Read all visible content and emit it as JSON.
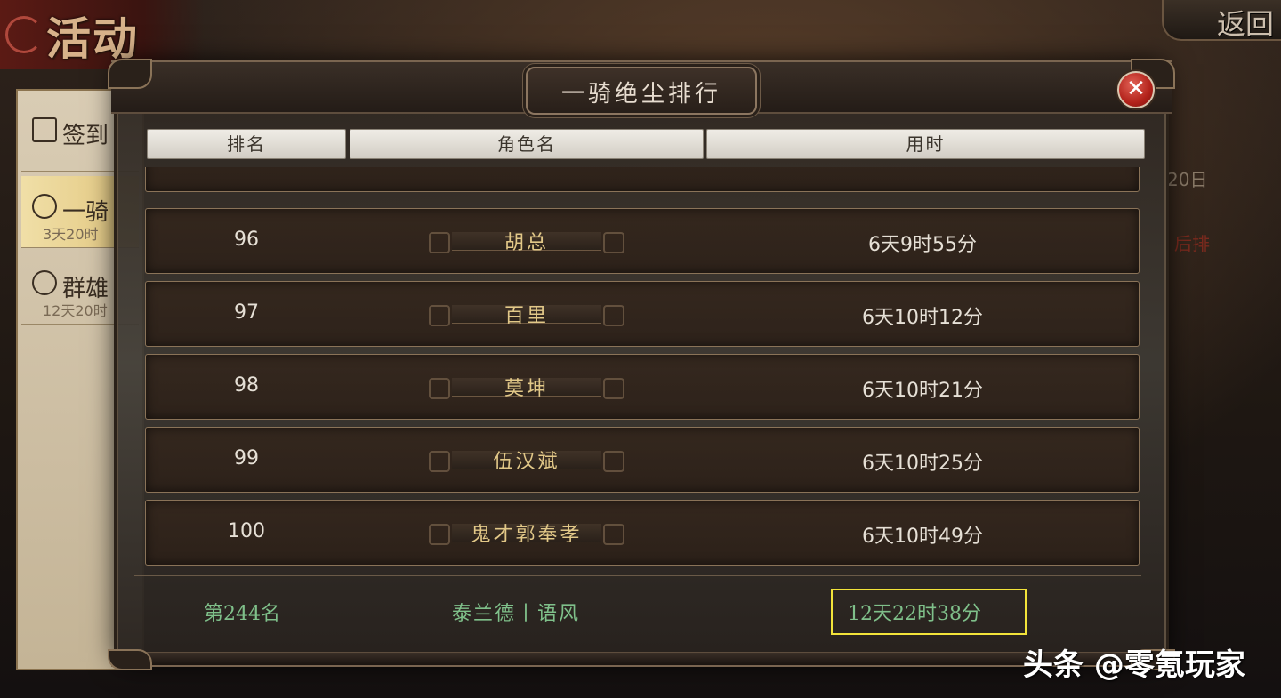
{
  "screen": {
    "title": "活动",
    "back_label": "返回"
  },
  "side_menu": {
    "items": [
      {
        "label": "签到",
        "sub": ""
      },
      {
        "label": "一骑",
        "sub": "3天20时"
      },
      {
        "label": "群雄",
        "sub": "12天20时"
      }
    ]
  },
  "background_text": {
    "date_fragment": "20日",
    "note_fragment": "后排"
  },
  "modal": {
    "title": "一骑绝尘排行",
    "columns": {
      "rank": "排名",
      "name": "角色名",
      "time": "用时"
    },
    "rows": [
      {
        "rank": "96",
        "name": "胡总",
        "time": "6天9时55分"
      },
      {
        "rank": "97",
        "name": "百里",
        "time": "6天10时12分"
      },
      {
        "rank": "98",
        "name": "莫坤",
        "time": "6天10时21分"
      },
      {
        "rank": "99",
        "name": "伍汉斌",
        "time": "6天10时25分"
      },
      {
        "rank": "100",
        "name": "鬼才郭奉孝",
        "time": "6天10时49分"
      }
    ],
    "my_entry": {
      "rank": "第244名",
      "name": "泰兰德丨语风",
      "time": "12天22时38分"
    }
  },
  "watermark": "头条 @零氪玩家",
  "colors": {
    "gold_text": "#e2c888",
    "green_text": "#7fc08a",
    "highlight": "#f2e33a",
    "close_red": "#b2221a"
  }
}
